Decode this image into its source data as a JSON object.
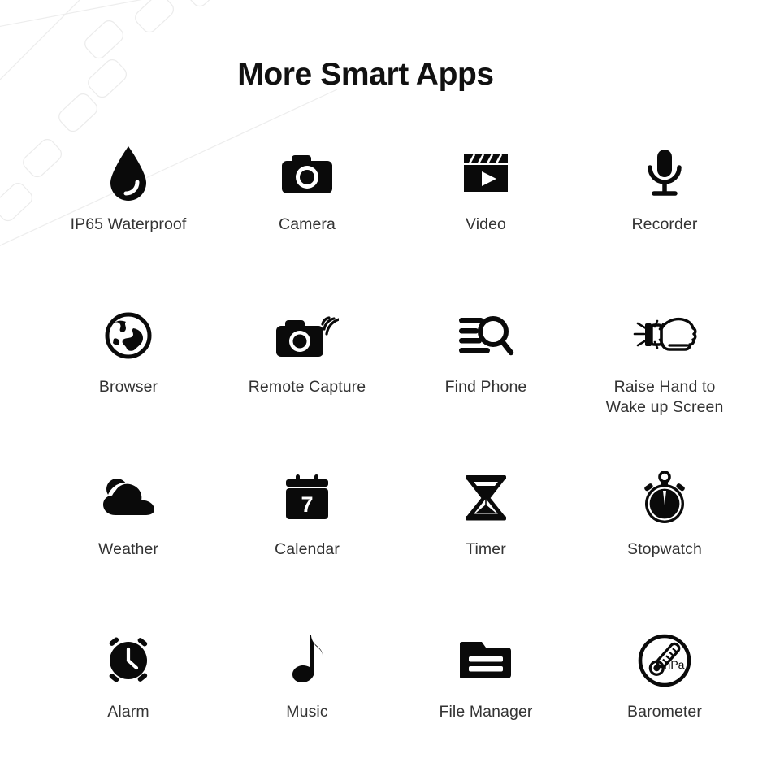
{
  "header": {
    "title": "More Smart Apps"
  },
  "theme": {
    "background": "#ffffff",
    "title_color": "#111111",
    "label_color": "#333333",
    "icon_color": "#0a0a0a",
    "watermark_color": "#eeeeee"
  },
  "grid": {
    "columns": 4,
    "rows": 4
  },
  "apps": [
    {
      "label": "IP65 Waterproof",
      "icon": "water-drop-icon"
    },
    {
      "label": "Camera",
      "icon": "camera-icon"
    },
    {
      "label": "Video",
      "icon": "clapperboard-play-icon"
    },
    {
      "label": "Recorder",
      "icon": "microphone-icon"
    },
    {
      "label": "Browser",
      "icon": "globe-icon"
    },
    {
      "label": "Remote Capture",
      "icon": "camera-wireless-icon"
    },
    {
      "label": "Find Phone",
      "icon": "list-magnifier-icon"
    },
    {
      "label": "Raise Hand to\nWake up Screen",
      "icon": "raise-hand-watch-icon"
    },
    {
      "label": "Weather",
      "icon": "cloud-sun-icon"
    },
    {
      "label": "Calendar",
      "icon": "calendar-icon"
    },
    {
      "label": "Timer",
      "icon": "hourglass-icon"
    },
    {
      "label": "Stopwatch",
      "icon": "stopwatch-icon"
    },
    {
      "label": "Alarm",
      "icon": "alarm-clock-icon"
    },
    {
      "label": "Music",
      "icon": "music-note-icon"
    },
    {
      "label": "File Manager",
      "icon": "folder-icon"
    },
    {
      "label": "Barometer",
      "icon": "barometer-hpa-icon"
    }
  ],
  "icon_text": {
    "calendar_day": "7",
    "barometer_unit": "hPa"
  }
}
